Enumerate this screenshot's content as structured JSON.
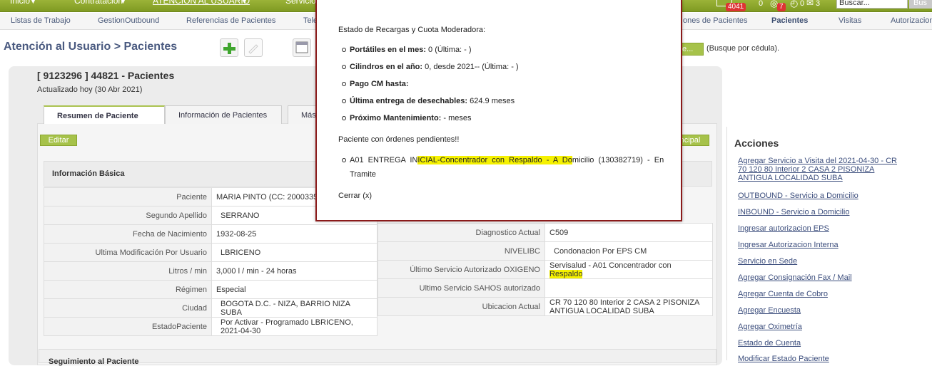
{
  "topnav": {
    "items": [
      "Inicio",
      "Contratación",
      "ATENCIÓN AL USUARIO",
      "Servicio"
    ],
    "badge_mail": "4041",
    "count_zero": "0",
    "badge_seven": "7",
    "count_a": "0",
    "count_b": "3",
    "search_placeholder": "Buscar...",
    "search_btn": "Bus"
  },
  "subnav": {
    "items": [
      "Listas de Trabajo",
      "GestionOutbound",
      "Referencias de Pacientes",
      "Tele"
    ],
    "right_items": [
      "ones de Pacientes",
      "Pacientes",
      "Visitas",
      "Autorizacion"
    ]
  },
  "page": {
    "title": "Atención al Usuario > Pacientes",
    "search_btn": "te...",
    "search_hint": "(Busque por cédula)."
  },
  "patient": {
    "header": "[ 9123296 ] 44821 - Pacientes",
    "updated": "Actualizado hoy (30 Abr 2021)",
    "tabs": [
      "Resumen de Paciente",
      "Información de Pacientes",
      "Más"
    ],
    "edit_btn": "Editar",
    "principal_btn": "ncipal",
    "section_title": "Información Básica",
    "left_rows": [
      {
        "label": "Paciente",
        "value": "MARIA PINTO (CC: 2000335"
      },
      {
        "label": "Segundo Apellido",
        "value": "SERRANO"
      },
      {
        "label": "Fecha de Nacimiento",
        "value": "1932-08-25"
      },
      {
        "label": "Ultima Modificación Por Usuario",
        "value": "LBRICENO"
      },
      {
        "label": "Litros / min",
        "value": "3,000 l / min - 24 horas"
      },
      {
        "label": "Régimen",
        "value": "Especial"
      },
      {
        "label": "Ciudad",
        "value": "BOGOTA D.C. - NIZA, BARRIO NIZA SUBA"
      },
      {
        "label": "EstadoPaciente",
        "value": "Por Activar - Programado LBRICENO, 2021-04-30"
      }
    ],
    "right_rows": [
      {
        "label": "Diagnostico Actual",
        "value": "C509"
      },
      {
        "label": "NIVELIBC",
        "value": "Condonacion Por EPS CM"
      },
      {
        "label": "Último Servicio Autorizado OXIGENO",
        "value_pre": "Servisalud - A01 Concentrador",
        "value_post": " con",
        "value_line2": "Respaldo"
      },
      {
        "label": "Ultimo Servicio SAHOS autorizado",
        "value": ""
      },
      {
        "label": "Ubicacion Actual",
        "value": "CR 70 120 80 Interior 2 CASA 2 PISONIZA ANTIGUA LOCALIDAD SUBA"
      }
    ],
    "section2_title": "Seguimiento al Paciente"
  },
  "actions": {
    "title": "Acciones",
    "links": [
      "Agregar Servicio a Visita del 2021-04-30 - CR 70 120 80 Interior 2 CASA 2 PISONIZA ANTIGUA LOCALIDAD SUBA",
      "OUTBOUND - Servicio a Domicilio",
      "INBOUND - Servicio a Domicilio",
      "Ingresar autorizacion EPS",
      "Ingresar Autorizacion Interna",
      "Servicio en Sede",
      "Agregar Consignación Fax / Mail",
      "Agregar Cuenta de Cobro",
      "Agregar Encuesta",
      "Agregar Oximetría",
      "Estado de Cuenta",
      "Modificar Estado Paciente"
    ]
  },
  "modal": {
    "heading": "Estado de Recargas y Cuota Moderadora:",
    "items": [
      {
        "label": "Portátiles en el mes:",
        "value": " 0 (Última: - )"
      },
      {
        "label": "Cilindros en el año:",
        "value": " 0, desde 2021-- (Última: - )"
      },
      {
        "label": "Pago CM hasta:",
        "value": ""
      },
      {
        "label": "Última entrega de desechables:",
        "value": " 624.9 meses"
      },
      {
        "label": "Próximo Mantenimiento:",
        "value": " - meses"
      }
    ],
    "pending": "Paciente con órdenes pendientes!!",
    "order_pre": "A01  ENTREGA  IN",
    "order_hl": "ICIAL-Concentrador  con  Respaldo  -  A  Do",
    "order_post": "micilio  (130382719)  -  En",
    "order_line2": "Tramite",
    "close": "Cerrar (x)"
  }
}
